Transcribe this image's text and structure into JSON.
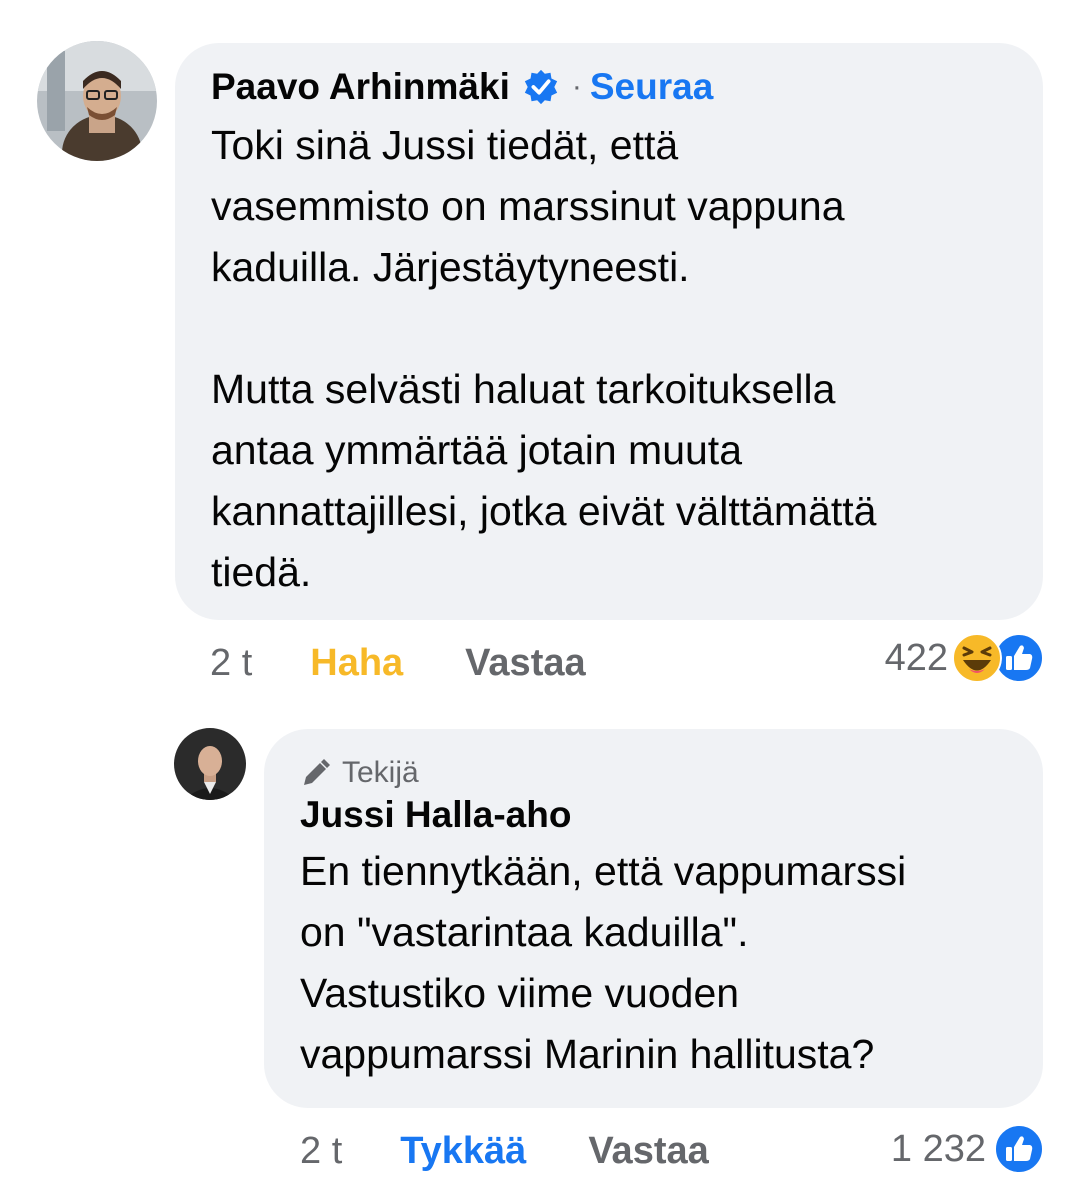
{
  "comment1": {
    "author": "Paavo Arhinmäki",
    "separator": "·",
    "follow_label": "Seuraa",
    "text": "Toki sinä Jussi tiedät, että\nvasemmisto on marssinut vappuna\nkaduilla. Järjestäytyneesti.\n\nMutta selvästi haluat tarkoituksella\nantaa ymmärtää jotain muuta\nkannattajillesi, jotka eivät välttämättä\ntiedä.",
    "time": "2 t",
    "reaction_label": "Haha",
    "reply_label": "Vastaa",
    "reaction_count": "422",
    "reaction_icons": [
      "haha-emoji-icon",
      "like-icon"
    ],
    "colors": {
      "reaction": "#f7b928"
    }
  },
  "comment2": {
    "author_tag": "Tekijä",
    "author": "Jussi Halla-aho",
    "text": "En tiennytkään, että vappumarssi\non \"vastarintaa kaduilla\".\nVastustiko viime vuoden\nvappumarssi Marinin hallitusta?",
    "time": "2 t",
    "reaction_label": "Tykkää",
    "reply_label": "Vastaa",
    "reaction_count": "1 232",
    "reaction_icons": [
      "like-icon"
    ],
    "colors": {
      "reaction": "#1877f2"
    }
  }
}
